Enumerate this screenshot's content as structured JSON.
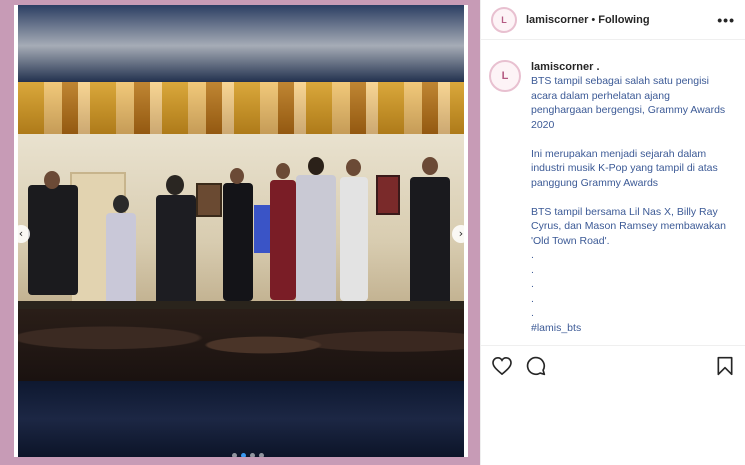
{
  "post": {
    "username": "lamiscorner",
    "separator": "•",
    "follow_status": "Following",
    "more_label": "•••",
    "avatar_text": "L"
  },
  "caption": {
    "username": "lamiscorner",
    "dot": ".",
    "text": "BTS tampil sebagai salah satu pengisi acara dalam perhelatan ajang penghargaan bergengsi, Grammy Awards 2020\n\nIni merupakan menjadi sejarah dalam industri musik K-Pop yang tampil di atas panggung Grammy Awards\n\nBTS tampil bersama Lil Nas X, Billy Ray Cyrus, dan Mason Ramsey membawakan 'Old Town Road'.\n.\n.\n.\n.\n.",
    "hashtag": "#lamis_bts"
  },
  "carousel": {
    "prev_arrow": "‹",
    "next_arrow": "›",
    "active_index": 1,
    "count": 4
  },
  "icons": {
    "like": "heart-icon",
    "comment": "comment-icon",
    "save": "bookmark-icon"
  },
  "colors": {
    "frame": "#c79bb6",
    "link": "#3c5a96",
    "dot_active": "#3897f0"
  }
}
